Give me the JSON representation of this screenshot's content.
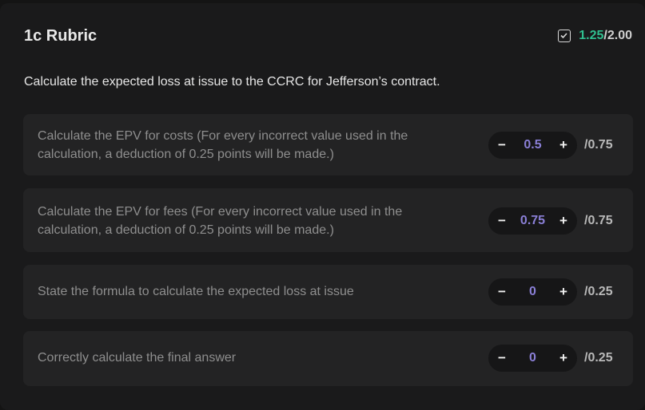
{
  "header": {
    "title": "1c Rubric",
    "score_got": "1.25",
    "score_total": "/2.00"
  },
  "question": "Calculate the expected loss at issue to the CCRC for Jefferson’s contract.",
  "criteria": [
    {
      "text_line1": "Calculate the EPV for costs (For every incorrect value used in the",
      "text_line2": "calculation, a deduction of 0.25 points will be made.)",
      "value": "0.5",
      "max": "/0.75",
      "minus": "−",
      "plus": "+"
    },
    {
      "text_line1": "Calculate the EPV for fees (For every incorrect value used in the",
      "text_line2": "calculation, a deduction of 0.25 points will be made.)",
      "value": "0.75",
      "max": "/0.75",
      "minus": "−",
      "plus": "+"
    },
    {
      "text_line1": "State the formula to calculate the expected loss at issue",
      "text_line2": "",
      "value": "0",
      "max": "/0.25",
      "minus": "−",
      "plus": "+"
    },
    {
      "text_line1": "Correctly calculate the final answer",
      "text_line2": "",
      "value": "0",
      "max": "/0.25",
      "minus": "−",
      "plus": "+"
    }
  ],
  "colors": {
    "accent_score": "#2fbf8f",
    "stepper_value": "#8a7fd6"
  },
  "icons": {
    "score_icon": "checkbox-check-icon"
  }
}
